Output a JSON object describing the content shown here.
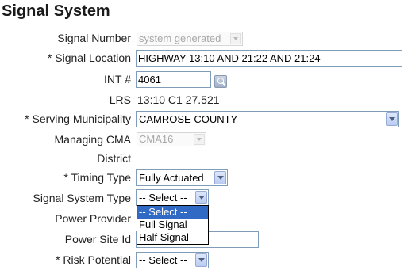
{
  "page": {
    "title": "Signal System"
  },
  "fields": {
    "signal_number": {
      "label": "Signal Number",
      "value": "system generated"
    },
    "signal_location": {
      "required": "* ",
      "label": "Signal Location",
      "value": "HIGHWAY 13:10 AND 21:22 AND 21:24"
    },
    "int_number": {
      "label": "INT #",
      "value": "4061",
      "lookup_icon": "magnifier-icon"
    },
    "lrs": {
      "label": "LRS",
      "value": "13:10 C1 27.521"
    },
    "serving_municipality": {
      "required": "* ",
      "label": "Serving Municipality",
      "value": "CAMROSE COUNTY"
    },
    "managing_cma": {
      "label": "Managing CMA",
      "value": "CMA16"
    },
    "district": {
      "label": "District",
      "value": ""
    },
    "timing_type": {
      "required": "* ",
      "label": "Timing Type",
      "value": "Fully Actuated"
    },
    "signal_system_type": {
      "label": "Signal System Type",
      "value": "-- Select --",
      "options": [
        "-- Select --",
        "Full Signal",
        "Half Signal"
      ]
    },
    "power_provider": {
      "label": "Power Provider",
      "value": ""
    },
    "power_site_id": {
      "label": "Power Site Id",
      "value": ""
    },
    "risk_potential": {
      "required": "* ",
      "label": "Risk Potential",
      "value": "-- Select --"
    }
  },
  "colors": {
    "dropdown_highlight": "#316ac5",
    "input_border": "#7f9db9",
    "disabled_text": "#a8a8a8"
  }
}
